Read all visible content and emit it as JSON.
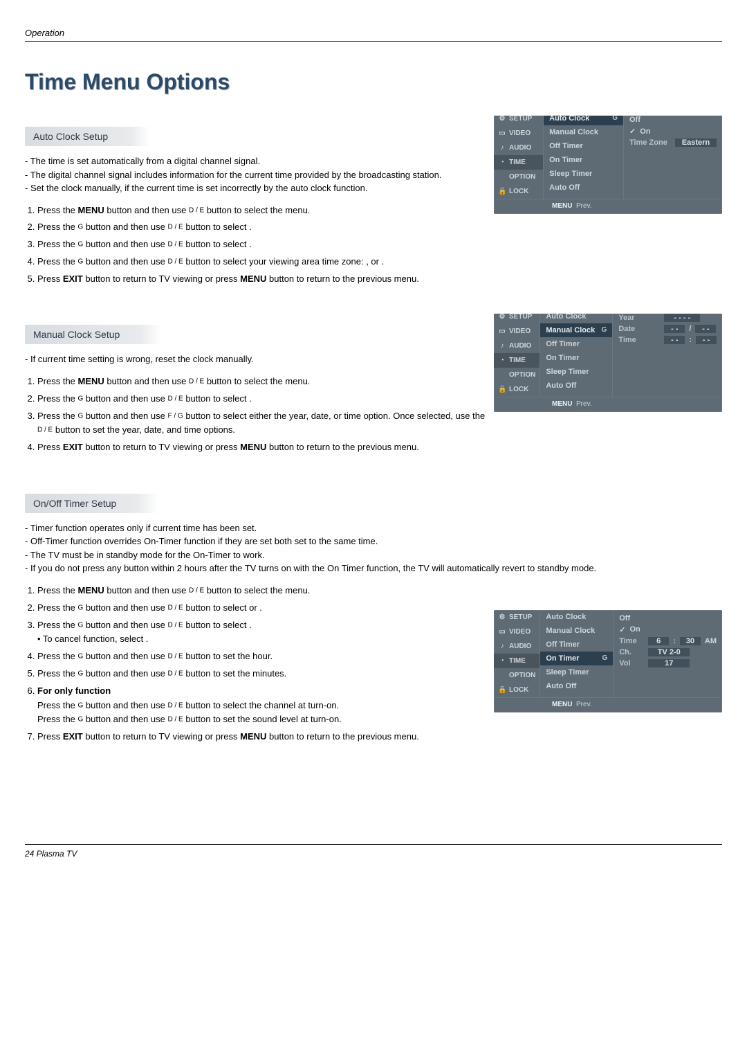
{
  "header": "Operation",
  "title": "Time Menu Options",
  "footer": "24  Plasma TV",
  "nav": {
    "de": "D / E",
    "fg": "F / G",
    "g": "G"
  },
  "btns": {
    "menu": "MENU",
    "exit": "EXIT"
  },
  "s1": {
    "heading": "Auto Clock Setup",
    "n1": "The time is set automatically from a digital channel signal.",
    "n2": "The digital channel signal includes information for the current time provided by the broadcasting station.",
    "n3": "Set the clock manually, if the current time is set incorrectly by the auto clock function.",
    "step1a": "Press the ",
    "step1b": " button and then use ",
    "step1c": " button to select the ",
    "step1d": " menu.",
    "step2a": "Press the ",
    "step2b": " button and then use ",
    "step2c": " button to select ",
    "step2d": ".",
    "step3a": "Press the ",
    "step3b": " button and then use ",
    "step3c": " button to select ",
    "step3d": ".",
    "step4a": "Press the ",
    "step4b": " button and then use ",
    "step4c": " button to select your viewing area time zone: ",
    "step4d": ", or ",
    "step4e": ".",
    "step5a": "Press ",
    "step5b": " button to return to TV viewing or press ",
    "step5c": " button to return to the previous menu."
  },
  "s2": {
    "heading": "Manual Clock Setup",
    "n1": "If current time setting is wrong, reset the clock manually.",
    "step1a": "Press the ",
    "step1b": " button and then use ",
    "step1c": " button to select the ",
    "step1d": " menu.",
    "step2a": "Press the ",
    "step2b": " button and then use ",
    "step2c": " button to select ",
    "step2d": ".",
    "step3a": "Press the ",
    "step3b": " button and then use ",
    "step3c": " button to select either the year, date, or time option. Once selected, use the ",
    "step3d": " button to set the year, date, and time options.",
    "step4a": "Press ",
    "step4b": " button to return to TV viewing or press ",
    "step4c": " button to return to the previous menu."
  },
  "s3": {
    "heading": "On/Off Timer Setup",
    "n1": "Timer function operates only if current time has been set.",
    "n2": "Off-Timer function overrides On-Timer function if they are set both set to the same time.",
    "n3": "The TV must be in standby mode for the On-Timer to work.",
    "n4": "If you do not press any button within 2 hours after the TV turns on with the On Timer function, the TV will automatically revert to standby mode.",
    "step1a": "Press the ",
    "step1b": " button and then use ",
    "step1c": " button to select the ",
    "step1d": " menu.",
    "step2a": "Press the ",
    "step2b": " button and then use ",
    "step2c": " button to select ",
    "step2d": " or ",
    "step2e": ".",
    "step3a": "Press the ",
    "step3b": " button and then use ",
    "step3c": " button to select ",
    "step3d": ".",
    "step3e": "• To cancel ",
    "step3f": " function, select ",
    "step3g": ".",
    "step4a": "Press the ",
    "step4b": " button and then use ",
    "step4c": " button to set the hour.",
    "step5a": "Press the ",
    "step5b": " button and then use ",
    "step5c": " button to set the minutes.",
    "step6a": "For only ",
    "step6b": " function",
    "step6c": "Press the ",
    "step6d": " button and then use ",
    "step6e": " button to select the channel at turn-on.",
    "step6f": "Press the ",
    "step6g": " button and then use ",
    "step6h": " button to set the sound level at turn-on.",
    "step7a": "Press ",
    "step7b": " button to return to TV viewing or press ",
    "step7c": " button to return to the previous menu."
  },
  "osd": {
    "tabs": [
      "SETUP",
      "VIDEO",
      "AUDIO",
      "TIME",
      "OPTION",
      "LOCK"
    ],
    "footMenu": "MENU",
    "footPrev": "Prev.",
    "m1": {
      "items": [
        "Auto Clock",
        "Manual Clock",
        "Off Timer",
        "On Timer",
        "Sleep Timer",
        "Auto Off"
      ],
      "selIndex": 0,
      "r_off": "Off",
      "r_on": "On",
      "tz_lab": "Time Zone",
      "tz_val": "Eastern"
    },
    "m2": {
      "items": [
        "Auto Clock",
        "Manual Clock",
        "Off Timer",
        "On Timer",
        "Sleep Timer",
        "Auto Off"
      ],
      "selIndex": 1,
      "year_lab": "Year",
      "year_val": "- - - -",
      "date_lab": "Date",
      "date_v1": "- -",
      "date_v2": "- -",
      "time_lab": "Time",
      "time_v1": "- -",
      "time_v2": "- -"
    },
    "m3": {
      "items": [
        "Auto Clock",
        "Manual Clock",
        "Off Timer",
        "On Timer",
        "Sleep Timer",
        "Auto Off"
      ],
      "selIndex": 3,
      "r_off": "Off",
      "r_on": "On",
      "time_lab": "Time",
      "time_h": "6",
      "time_m": "30",
      "time_ap": "AM",
      "ch_lab": "Ch.",
      "ch_val": "TV  2-0",
      "vol_lab": "Vol",
      "vol_val": "17"
    }
  }
}
